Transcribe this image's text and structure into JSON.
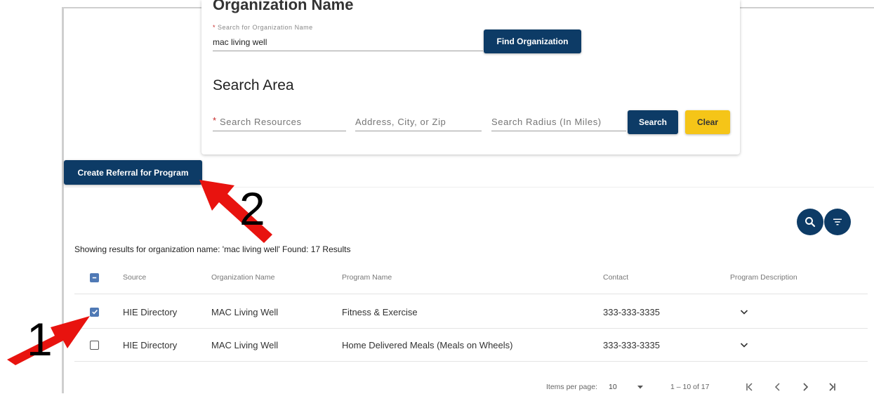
{
  "org_search": {
    "heading": "Organization Name",
    "required_mark": "*",
    "field_label": "Search for Organization Name",
    "field_value": "mac living well",
    "find_button": "Find Organization"
  },
  "search_area": {
    "heading": "Search Area",
    "required_mark": "*",
    "resources_placeholder": "Search Resources",
    "address_placeholder": "Address, City, or Zip",
    "radius_placeholder": "Search Radius (In Miles)",
    "search_button": "Search",
    "clear_button": "Clear"
  },
  "create_referral_button": "Create Referral for Program",
  "results_summary": "Showing results for organization name: 'mac living well' Found: 17 Results",
  "icons": {
    "search": "search-icon",
    "filter": "filter-icon",
    "expand": "chevron-down-icon"
  },
  "table": {
    "headers": {
      "source": "Source",
      "organization": "Organization Name",
      "program": "Program Name",
      "contact": "Contact",
      "description": "Program Description"
    },
    "rows": [
      {
        "checked": true,
        "source": "HIE Directory",
        "organization": "MAC Living Well",
        "program": "Fitness & Exercise",
        "contact": "333-333-3335"
      },
      {
        "checked": false,
        "source": "HIE Directory",
        "organization": "MAC Living Well",
        "program": "Home Delivered Meals (Meals on Wheels)",
        "contact": "333-333-3335"
      }
    ]
  },
  "pagination": {
    "items_per_page_label": "Items per page:",
    "items_per_page_value": "10",
    "range": "1 – 10 of 17"
  },
  "annotations": {
    "step1": "1",
    "step2": "2"
  },
  "colors": {
    "navy": "#0d3b66",
    "yellow": "#f5c518",
    "checkbox_blue": "#4f79b5",
    "annotation_red": "#e8130f"
  }
}
